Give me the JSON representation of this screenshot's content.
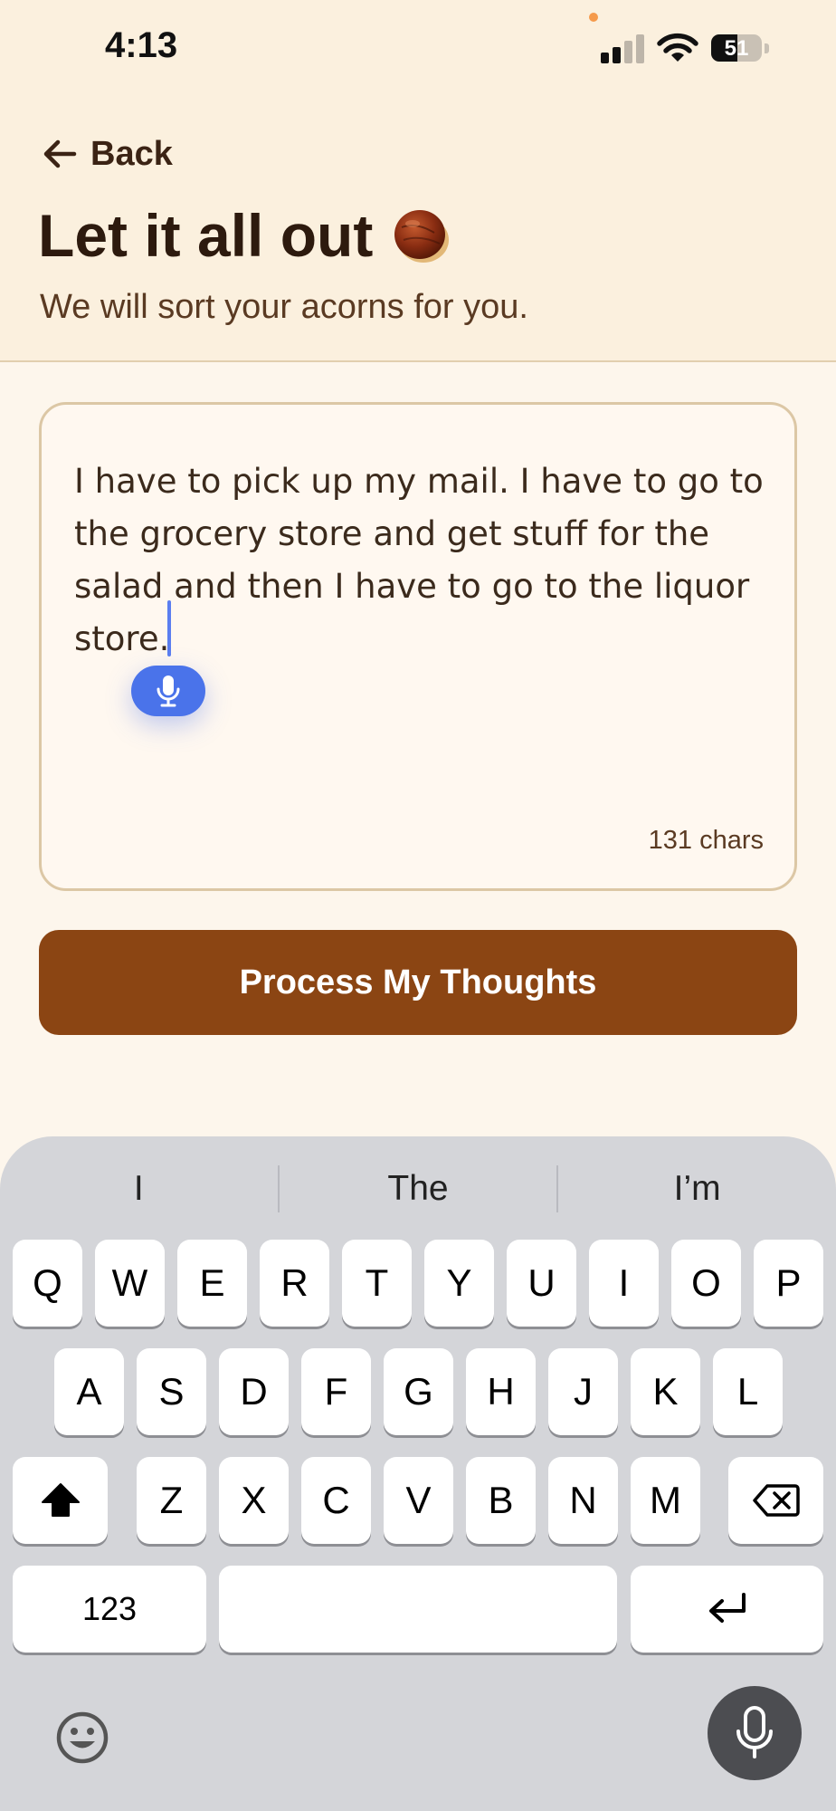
{
  "status_bar": {
    "time": "4:13",
    "battery_level": "51"
  },
  "nav": {
    "back_label": "Back"
  },
  "header": {
    "title": "Let it all out",
    "subtitle": "We will sort your acorns for you."
  },
  "editor": {
    "text": "I have to pick up my mail. I have to go to the grocery store and get stuff for the salad and then I have to go to the liquor store.",
    "char_count": "131 chars"
  },
  "process_button": {
    "label": "Process My Thoughts"
  },
  "keyboard": {
    "suggestions": [
      "I",
      "The",
      "I’m"
    ],
    "row1": [
      "Q",
      "W",
      "E",
      "R",
      "T",
      "Y",
      "U",
      "I",
      "O",
      "P"
    ],
    "row2": [
      "A",
      "S",
      "D",
      "F",
      "G",
      "H",
      "J",
      "K",
      "L"
    ],
    "row3": [
      "Z",
      "X",
      "C",
      "V",
      "B",
      "N",
      "M"
    ],
    "numbers_label": "123"
  },
  "colors": {
    "header_bg": "#fbf0de",
    "page_bg": "#fdf6ec",
    "button_bg": "#8b4513",
    "accent_blue": "#4a73ea",
    "keyboard_bg": "#d4d5d9"
  },
  "icons": {
    "back": "arrow-left-icon",
    "title_emoji": "acorn-icon",
    "dictation": "microphone-icon",
    "shift": "shift-icon",
    "delete": "backspace-icon",
    "return": "return-icon",
    "emoji": "emoji-icon",
    "keyboard_mic": "microphone-icon"
  }
}
